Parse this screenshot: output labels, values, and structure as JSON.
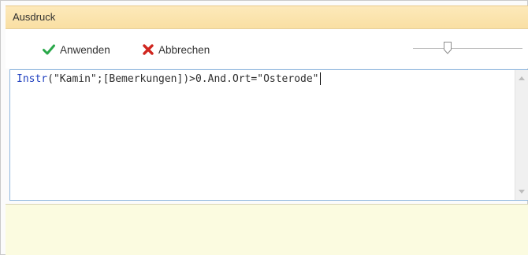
{
  "window": {
    "title": "Ausdruck"
  },
  "toolbar": {
    "apply_label": "Anwenden",
    "cancel_label": "Abbrechen",
    "zoom_slider_level": 0.3
  },
  "editor": {
    "expression_function": "Instr",
    "expression_rest": "(\"Kamin\";[Bemerkungen])>0.And.Ort=\"Osterode\""
  },
  "colors": {
    "titlebar": "#fbe3ad",
    "apply_icon": "#2aa84a",
    "cancel_icon": "#d0261f",
    "editor_border": "#8fb7de",
    "keyword": "#1f3fbf",
    "info_panel": "#fbfbe0"
  }
}
